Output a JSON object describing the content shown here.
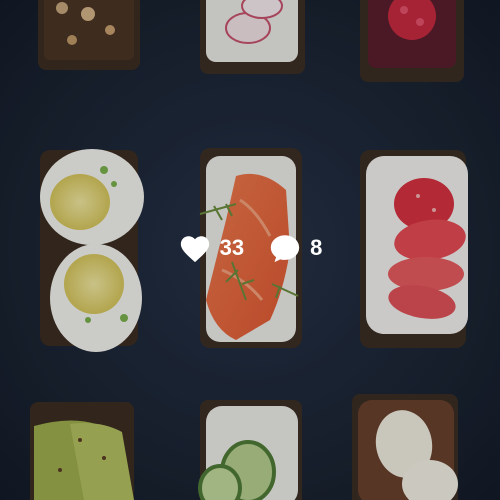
{
  "overlay": {
    "likes": {
      "icon": "heart-icon",
      "count": "33"
    },
    "comments": {
      "icon": "comment-icon",
      "count": "8"
    },
    "text_color": "#ffffff"
  },
  "photo": {
    "background_color": "#1a2130"
  }
}
